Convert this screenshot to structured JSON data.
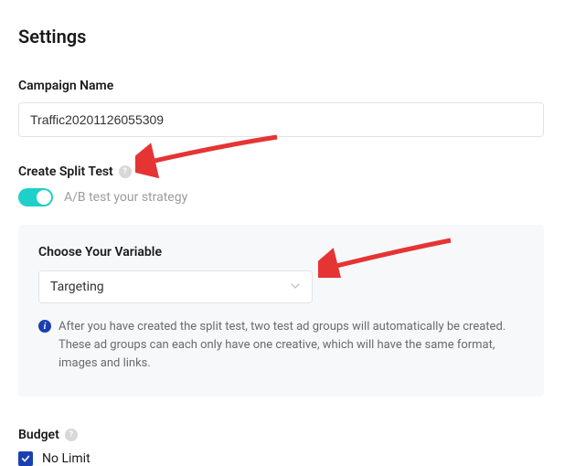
{
  "title": "Settings",
  "campaign": {
    "label": "Campaign Name",
    "value": "Traffic20201126055309"
  },
  "split_test": {
    "label": "Create Split Test",
    "caption": "A/B test your strategy",
    "enabled": true
  },
  "variable_panel": {
    "label": "Choose Your Variable",
    "selected": "Targeting",
    "info": "After you have created the split test, two test ad groups will automatically be created. These ad groups can each only have one creative, which will have the same format, images and links."
  },
  "budget": {
    "label": "Budget",
    "no_limit_label": "No Limit",
    "no_limit_checked": true
  }
}
